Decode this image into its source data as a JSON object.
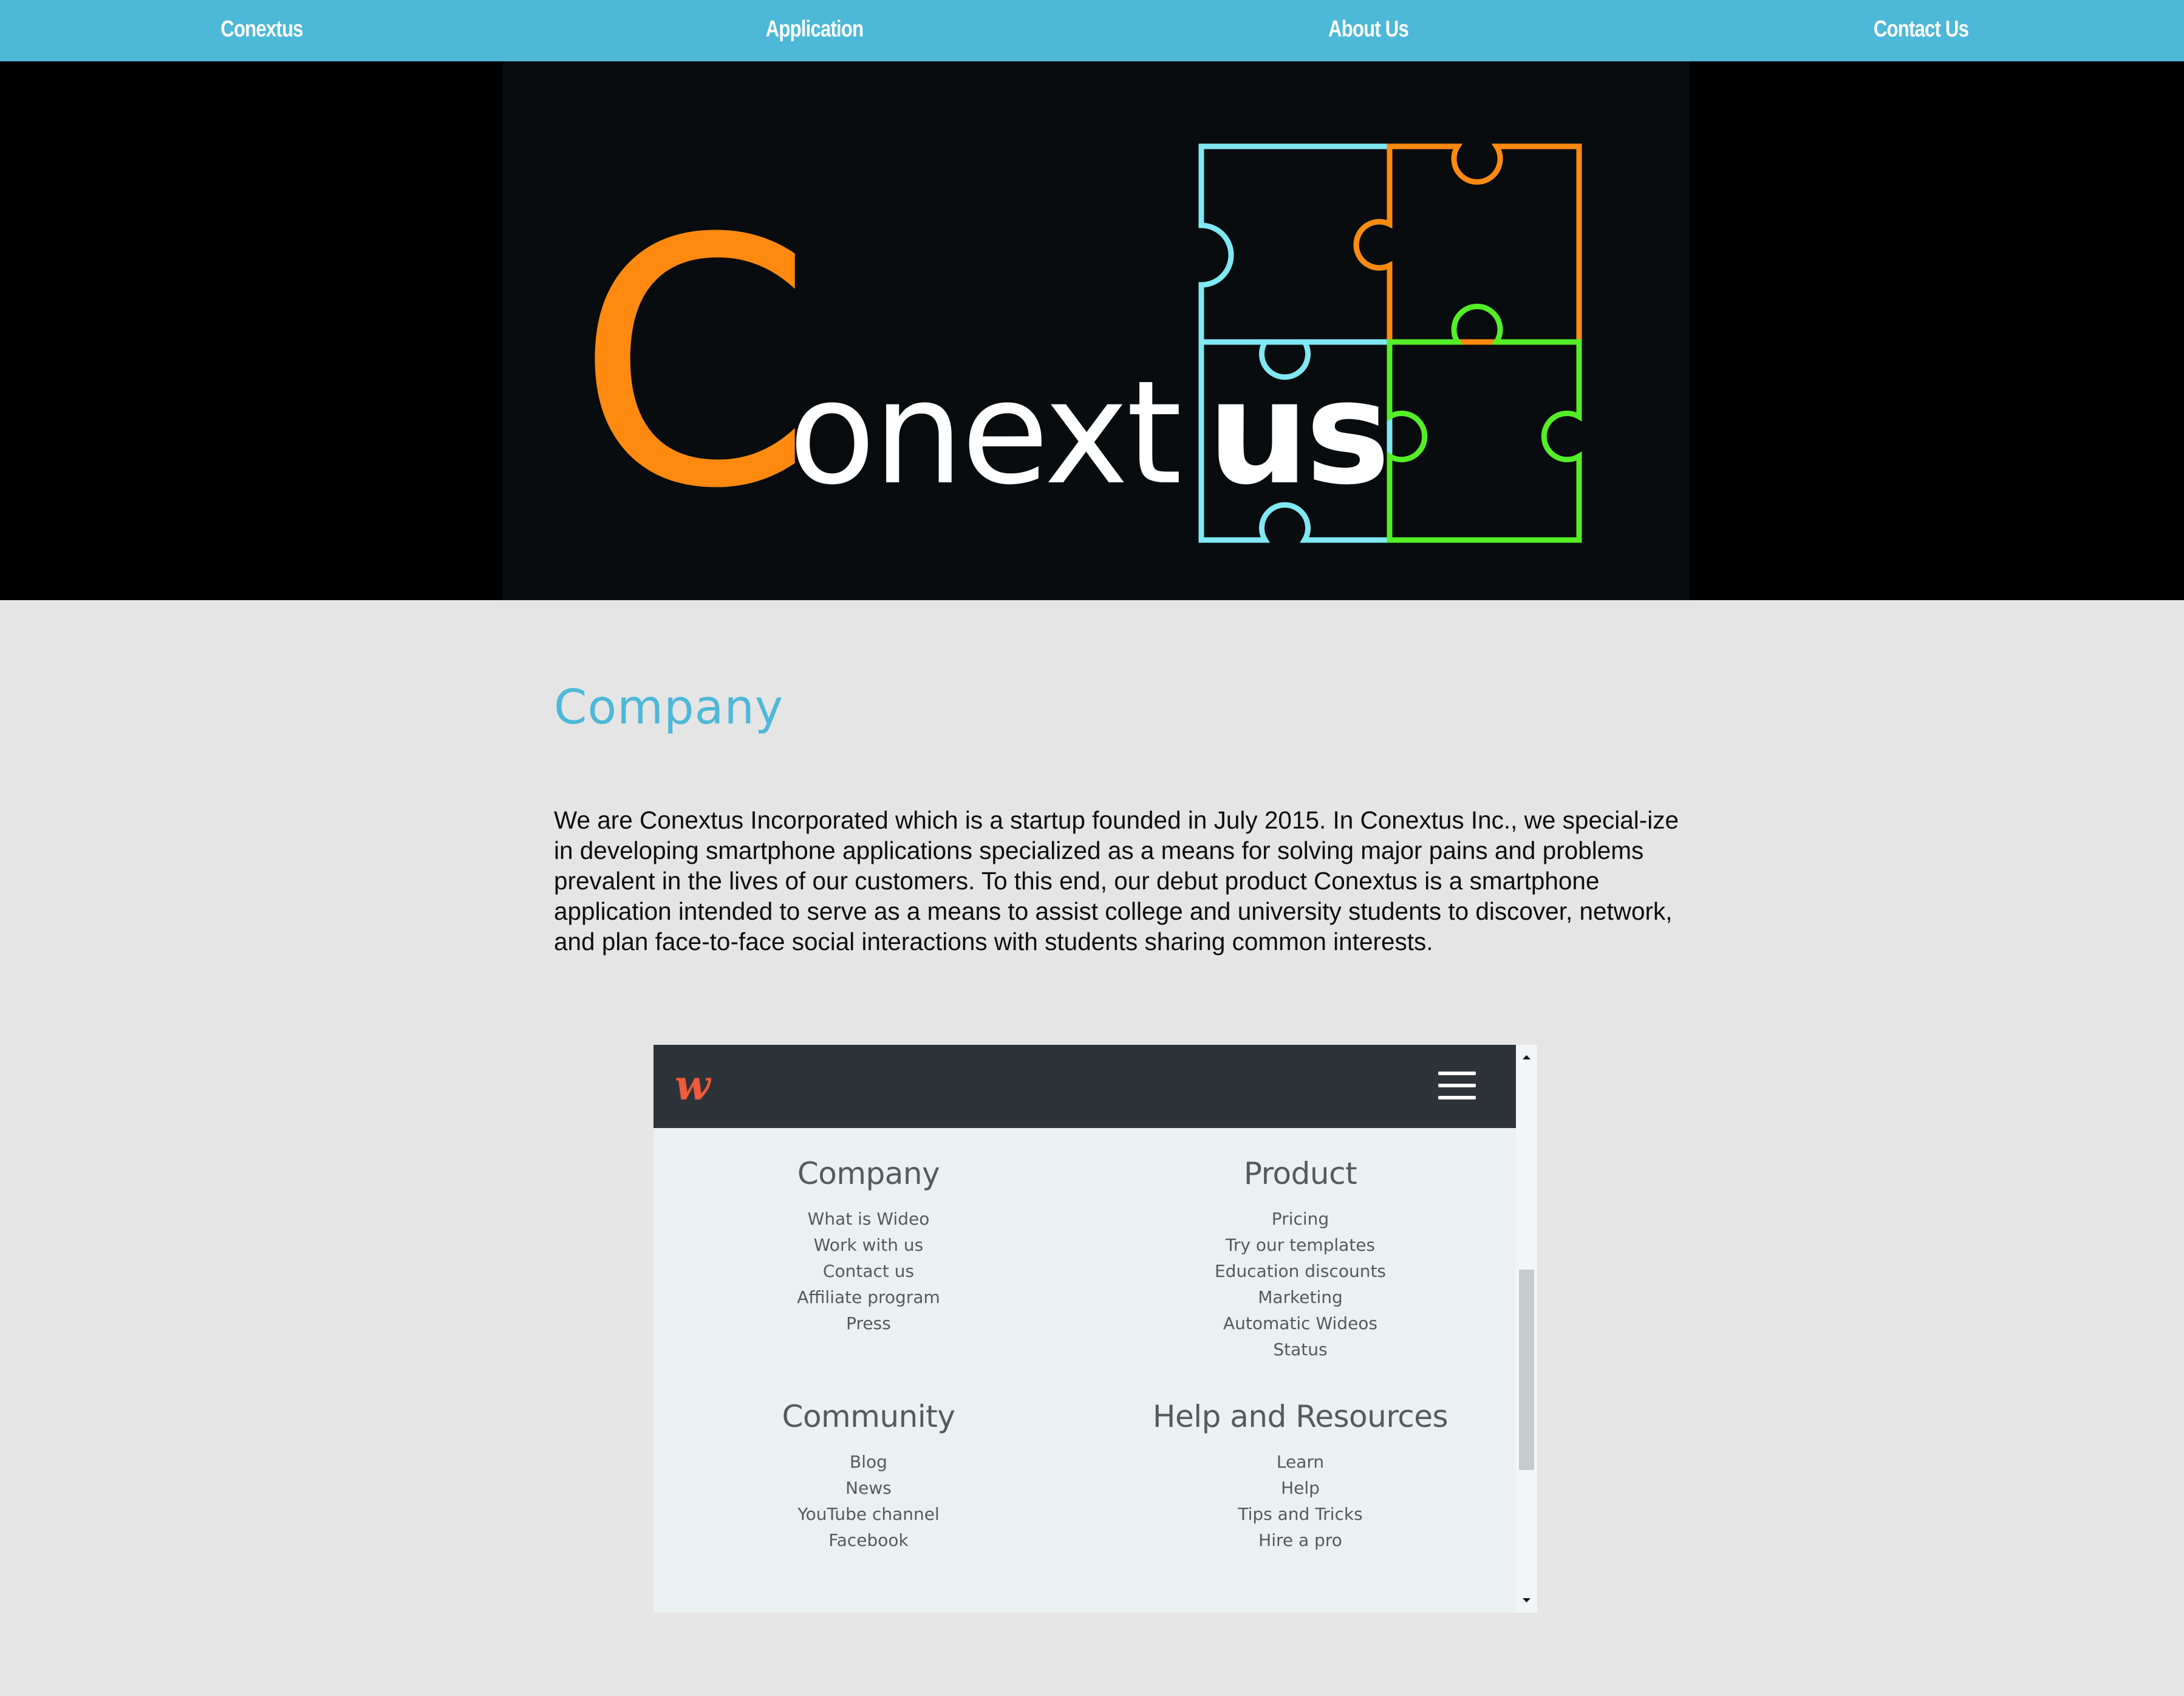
{
  "nav": {
    "items": [
      {
        "label": "Conextus"
      },
      {
        "label": "Application"
      },
      {
        "label": "About Us"
      },
      {
        "label": "Contact Us"
      }
    ]
  },
  "hero": {
    "logo_first_letter": "C",
    "logo_middle": "onext",
    "logo_end": "us",
    "colors": {
      "orange": "#ff8a0f",
      "cyan": "#80e8f3",
      "green": "#54ee27",
      "white": "#ffffff"
    }
  },
  "company": {
    "title": "Company",
    "intro": "We are Conextus Incorporated which is a startup founded in July 2015. In Conextus Inc., we special-ize in developing smartphone applications specialized as a means for solving major pains and problems prevalent in the lives of our customers. To this end, our debut product Conextus is a smartphone application intended to serve as a means to assist college and university students to discover, network, and plan face-to-face social interactions with students sharing common interests."
  },
  "embed": {
    "logo_glyph": "w",
    "logo_color": "#ef5b3b",
    "menu_icon": "hamburger-icon",
    "columns": [
      {
        "title": "Company",
        "links": [
          "What is Wideo",
          "Work with us",
          "Contact us",
          "Affiliate program",
          "Press"
        ]
      },
      {
        "title": "Product",
        "links": [
          "Pricing",
          "Try our templates",
          "Education discounts",
          "Marketing",
          "Automatic Wideos",
          "Status"
        ]
      },
      {
        "title": "Community",
        "links": [
          "Blog",
          "News",
          "YouTube channel",
          "Facebook"
        ]
      },
      {
        "title": "Help and Resources",
        "links": [
          "Learn",
          "Help",
          "Tips and Tricks",
          "Hire a pro"
        ]
      }
    ]
  }
}
